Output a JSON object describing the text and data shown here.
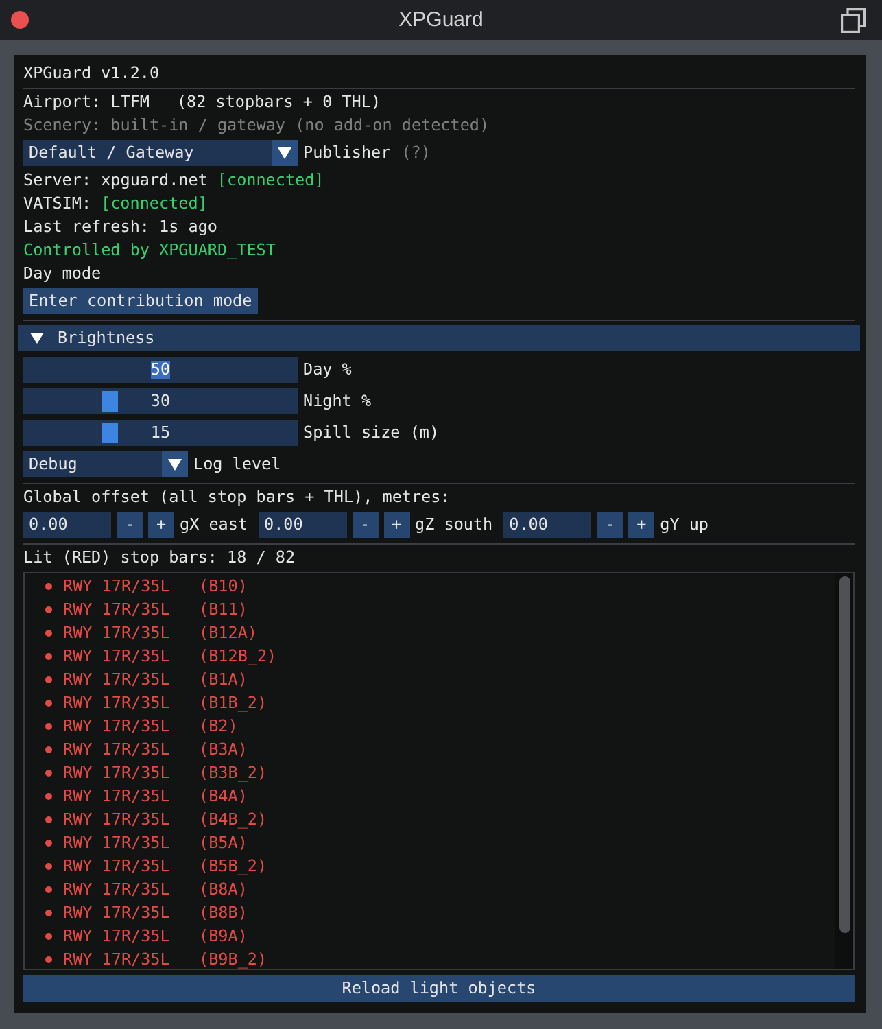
{
  "window": {
    "title": "XPGuard"
  },
  "version": "XPGuard v1.2.0",
  "airport": {
    "label": "Airport: LTFM",
    "count": "(82 stopbars + 0 THL)"
  },
  "scenery": "Scenery: built-in / gateway (no add-on detected)",
  "publisher": {
    "value": "Default / Gateway",
    "label": "Publisher",
    "help": "(?)"
  },
  "connections": [
    {
      "label": "Server: xpguard.net",
      "status": "[connected]",
      "connected": true
    },
    {
      "label": "VATSIM:",
      "status": "[connected]",
      "connected": true
    }
  ],
  "last_refresh": "Last refresh: 1s ago",
  "control": {
    "text": "Controlled by XPGUARD_TEST",
    "active": true
  },
  "mode": "Day mode",
  "contribution_button": "Enter contribution mode",
  "brightness": {
    "title": "Brightness",
    "expanded": true,
    "sliders": [
      {
        "value": "50",
        "label": "Day %",
        "editing": true
      },
      {
        "value": "30",
        "label": "Night %",
        "editing": false,
        "level": 0.3
      },
      {
        "value": "15",
        "label": "Spill size (m)",
        "editing": false,
        "level": 0.3
      }
    ],
    "log_level": {
      "value": "Debug",
      "label": "Log level"
    }
  },
  "offset": {
    "title": "Global offset (all stop bars + THL), metres:",
    "axes": [
      {
        "field": {
          "value": "0.00"
        },
        "minus": "-",
        "plus": "+",
        "label": "gX east"
      },
      {
        "field": {
          "value": "0.00"
        },
        "minus": "-",
        "plus": "+",
        "label": "gZ south"
      },
      {
        "field": {
          "value": "0.00"
        },
        "minus": "-",
        "plus": "+",
        "label": "gY up"
      }
    ]
  },
  "lit": {
    "title": "Lit (RED) stop bars: 18 / 82",
    "items": [
      "RWY 17R/35L   (B10)",
      "RWY 17R/35L   (B11)",
      "RWY 17R/35L   (B12A)",
      "RWY 17R/35L   (B12B_2)",
      "RWY 17R/35L   (B1A)",
      "RWY 17R/35L   (B1B_2)",
      "RWY 17R/35L   (B2)",
      "RWY 17R/35L   (B3A)",
      "RWY 17R/35L   (B3B_2)",
      "RWY 17R/35L   (B4A)",
      "RWY 17R/35L   (B4B_2)",
      "RWY 17R/35L   (B5A)",
      "RWY 17R/35L   (B5B_2)",
      "RWY 17R/35L   (B8A)",
      "RWY 17R/35L   (B8B)",
      "RWY 17R/35L   (B9A)",
      "RWY 17R/35L   (B9B_2)"
    ]
  },
  "reload_button": "Reload light objects"
}
